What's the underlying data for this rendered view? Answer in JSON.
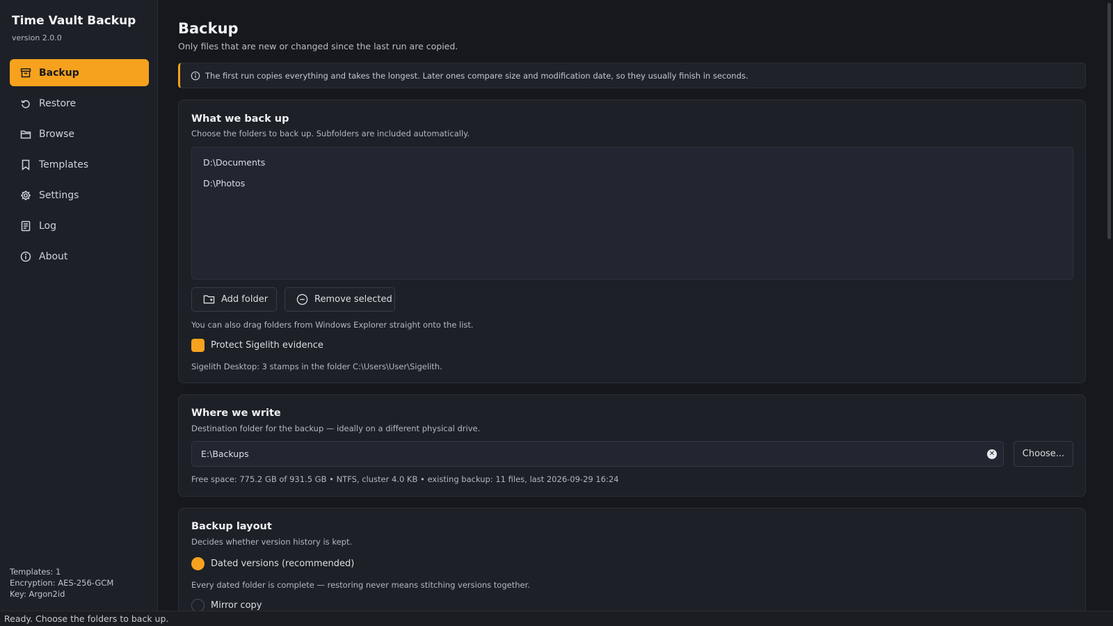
{
  "app": {
    "title": "Time Vault Backup",
    "version": "version 2.0.0"
  },
  "sidebar": {
    "items": [
      {
        "label": "Backup",
        "icon": "archive-icon",
        "active": true
      },
      {
        "label": "Restore",
        "icon": "restore-icon"
      },
      {
        "label": "Browse",
        "icon": "folder-icon"
      },
      {
        "label": "Templates",
        "icon": "bookmark-icon"
      },
      {
        "label": "Settings",
        "icon": "gear-icon"
      },
      {
        "label": "Log",
        "icon": "log-icon"
      },
      {
        "label": "About",
        "icon": "info-icon"
      }
    ],
    "footer": {
      "templates": "Templates: 1",
      "encryption": "Encryption: AES-256-GCM",
      "key": "Key: Argon2id"
    }
  },
  "page": {
    "title": "Backup",
    "subtitle": "Only files that are new or changed since the last run are copied.",
    "banner": "The first run copies everything and takes the longest. Later ones compare size and modification date, so they usually finish in seconds."
  },
  "what": {
    "title": "What we back up",
    "desc": "Choose the folders to back up. Subfolders are included automatically.",
    "folders": [
      "D:\\Documents",
      "D:\\Photos"
    ],
    "add_label": "Add folder",
    "remove_label": "Remove selected",
    "drag_hint": "You can also drag folders from Windows Explorer straight onto the list.",
    "protect_label": "Protect Sigelith evidence",
    "protect_checked": true,
    "sigelith_info": "Sigelith Desktop: 3 stamps in the folder C:\\Users\\User\\Sigelith."
  },
  "where": {
    "title": "Where we write",
    "desc": "Destination folder for the backup — ideally on a different physical drive.",
    "path": "E:\\Backups",
    "choose_label": "Choose...",
    "free_space": "Free space: 775.2 GB of 931.5 GB • NTFS, cluster 4.0 KB • existing backup: 11 files, last 2026-09-29 16:24"
  },
  "layout": {
    "title": "Backup layout",
    "desc": "Decides whether version history is kept.",
    "option_dated": "Dated versions (recommended)",
    "dated_desc": "Every dated folder is complete — restoring never means stitching versions together.",
    "option_mirror": "Mirror copy",
    "selected": "dated"
  },
  "status": {
    "text": "Ready. Choose the folders to back up."
  },
  "colors": {
    "accent": "#f6a21e",
    "background": "#16181d",
    "panel": "#1d2027"
  }
}
